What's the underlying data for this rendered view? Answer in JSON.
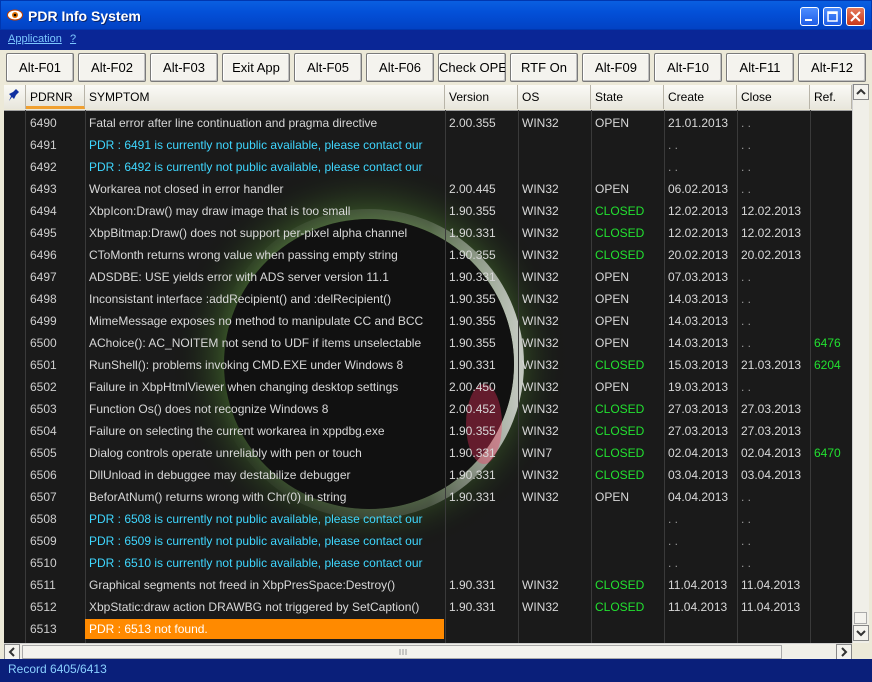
{
  "window": {
    "title": "PDR Info System"
  },
  "menu": {
    "items": [
      "Application",
      "?"
    ]
  },
  "toolbar": {
    "buttons": [
      "Alt-F01",
      "Alt-F02",
      "Alt-F03",
      "Exit App",
      "Alt-F05",
      "Alt-F06",
      "Check OPEN",
      "RTF On",
      "Alt-F09",
      "Alt-F10",
      "Alt-F11",
      "Alt-F12"
    ]
  },
  "grid": {
    "columns": [
      "PDRNR",
      "SYMPTOM",
      "Version",
      "OS",
      "State",
      "Create",
      "Close",
      "Ref."
    ],
    "rows": [
      {
        "nr": "6490",
        "symptom": "Fatal error after line continuation and pragma directive",
        "version": "2.00.355",
        "os": "WIN32",
        "state": "OPEN",
        "create": "21.01.2013",
        "close": ". .",
        "ref": ""
      },
      {
        "nr": "6491",
        "symptom": "PDR : 6491 is currently not public available, please contact our",
        "version": "",
        "os": "",
        "state": "",
        "create": ". .",
        "close": ". .",
        "ref": "",
        "kind": "na"
      },
      {
        "nr": "6492",
        "symptom": "PDR : 6492 is currently not public available, please contact our",
        "version": "",
        "os": "",
        "state": "",
        "create": ". .",
        "close": ". .",
        "ref": "",
        "kind": "na"
      },
      {
        "nr": "6493",
        "symptom": "Workarea not closed in error handler",
        "version": "2.00.445",
        "os": "WIN32",
        "state": "OPEN",
        "create": "06.02.2013",
        "close": ". .",
        "ref": ""
      },
      {
        "nr": "6494",
        "symptom": "XbpIcon:Draw() may draw image that is too small",
        "version": "1.90.355",
        "os": "WIN32",
        "state": "CLOSED",
        "create": "12.02.2013",
        "close": "12.02.2013",
        "ref": ""
      },
      {
        "nr": "6495",
        "symptom": "XbpBitmap:Draw() does not support per-pixel alpha channel",
        "version": "1.90.331",
        "os": "WIN32",
        "state": "CLOSED",
        "create": "12.02.2013",
        "close": "12.02.2013",
        "ref": ""
      },
      {
        "nr": "6496",
        "symptom": "CToMonth returns wrong value when passing empty string",
        "version": "1.90.355",
        "os": "WIN32",
        "state": "CLOSED",
        "create": "20.02.2013",
        "close": "20.02.2013",
        "ref": ""
      },
      {
        "nr": "6497",
        "symptom": "ADSDBE: USE yields error with ADS server version 11.1",
        "version": "1.90.331",
        "os": "WIN32",
        "state": "OPEN",
        "create": "07.03.2013",
        "close": ". .",
        "ref": ""
      },
      {
        "nr": "6498",
        "symptom": "Inconsistant interface :addRecipient() and :delRecipient()",
        "version": "1.90.355",
        "os": "WIN32",
        "state": "OPEN",
        "create": "14.03.2013",
        "close": ". .",
        "ref": ""
      },
      {
        "nr": "6499",
        "symptom": "MimeMessage exposes no method to manipulate CC and BCC",
        "version": "1.90.355",
        "os": "WIN32",
        "state": "OPEN",
        "create": "14.03.2013",
        "close": ". .",
        "ref": ""
      },
      {
        "nr": "6500",
        "symptom": "AChoice(): AC_NOITEM not send to UDF if items unselectable",
        "version": "1.90.355",
        "os": "WIN32",
        "state": "OPEN",
        "create": "14.03.2013",
        "close": ". .",
        "ref": "6476"
      },
      {
        "nr": "6501",
        "symptom": "RunShell(): problems invoking CMD.EXE under Windows 8",
        "version": "1.90.331",
        "os": "WIN32",
        "state": "CLOSED",
        "create": "15.03.2013",
        "close": "21.03.2013",
        "ref": "6204"
      },
      {
        "nr": "6502",
        "symptom": "Failure in XbpHtmlViewer when changing desktop settings",
        "version": "2.00.450",
        "os": "WIN32",
        "state": "OPEN",
        "create": "19.03.2013",
        "close": ". .",
        "ref": ""
      },
      {
        "nr": "6503",
        "symptom": "Function Os() does not recognize Windows 8",
        "version": "2.00.452",
        "os": "WIN32",
        "state": "CLOSED",
        "create": "27.03.2013",
        "close": "27.03.2013",
        "ref": ""
      },
      {
        "nr": "6504",
        "symptom": "Failure on selecting the current workarea in xppdbg.exe",
        "version": "1.90.355",
        "os": "WIN32",
        "state": "CLOSED",
        "create": "27.03.2013",
        "close": "27.03.2013",
        "ref": ""
      },
      {
        "nr": "6505",
        "symptom": "Dialog controls operate unreliably with pen or touch",
        "version": "1.90.331",
        "os": "WIN7",
        "state": "CLOSED",
        "create": "02.04.2013",
        "close": "02.04.2013",
        "ref": "6470"
      },
      {
        "nr": "6506",
        "symptom": "DllUnload in debuggee may destabilize debugger",
        "version": "1.90.331",
        "os": "WIN32",
        "state": "CLOSED",
        "create": "03.04.2013",
        "close": "03.04.2013",
        "ref": ""
      },
      {
        "nr": "6507",
        "symptom": "BeforAtNum() returns wrong with Chr(0) in string",
        "version": "1.90.331",
        "os": "WIN32",
        "state": "OPEN",
        "create": "04.04.2013",
        "close": ". .",
        "ref": ""
      },
      {
        "nr": "6508",
        "symptom": "PDR : 6508 is currently not public available, please contact our",
        "version": "",
        "os": "",
        "state": "",
        "create": ". .",
        "close": ". .",
        "ref": "",
        "kind": "na"
      },
      {
        "nr": "6509",
        "symptom": "PDR : 6509 is currently not public available, please contact our",
        "version": "",
        "os": "",
        "state": "",
        "create": ". .",
        "close": ". .",
        "ref": "",
        "kind": "na"
      },
      {
        "nr": "6510",
        "symptom": "PDR : 6510 is currently not public available, please contact our",
        "version": "",
        "os": "",
        "state": "",
        "create": ". .",
        "close": ". .",
        "ref": "",
        "kind": "na"
      },
      {
        "nr": "6511",
        "symptom": "Graphical segments not freed in XbpPresSpace:Destroy()",
        "version": "1.90.331",
        "os": "WIN32",
        "state": "CLOSED",
        "create": "11.04.2013",
        "close": "11.04.2013",
        "ref": ""
      },
      {
        "nr": "6512",
        "symptom": "XbpStatic:draw action DRAWBG not triggered by SetCaption()",
        "version": "1.90.331",
        "os": "WIN32",
        "state": "CLOSED",
        "create": "11.04.2013",
        "close": "11.04.2013",
        "ref": ""
      },
      {
        "nr": "6513",
        "symptom": "PDR : 6513 not found.",
        "version": "",
        "os": "",
        "state": "",
        "create": "",
        "close": "",
        "ref": "",
        "kind": "notfound"
      }
    ]
  },
  "status": {
    "text": "Record 6405/6413"
  },
  "colors": {
    "open": "#d8d8d8",
    "closed": "#22e030",
    "na": "#3fd7ff",
    "notfound": "#ff8a00",
    "ref": "#22e030"
  }
}
